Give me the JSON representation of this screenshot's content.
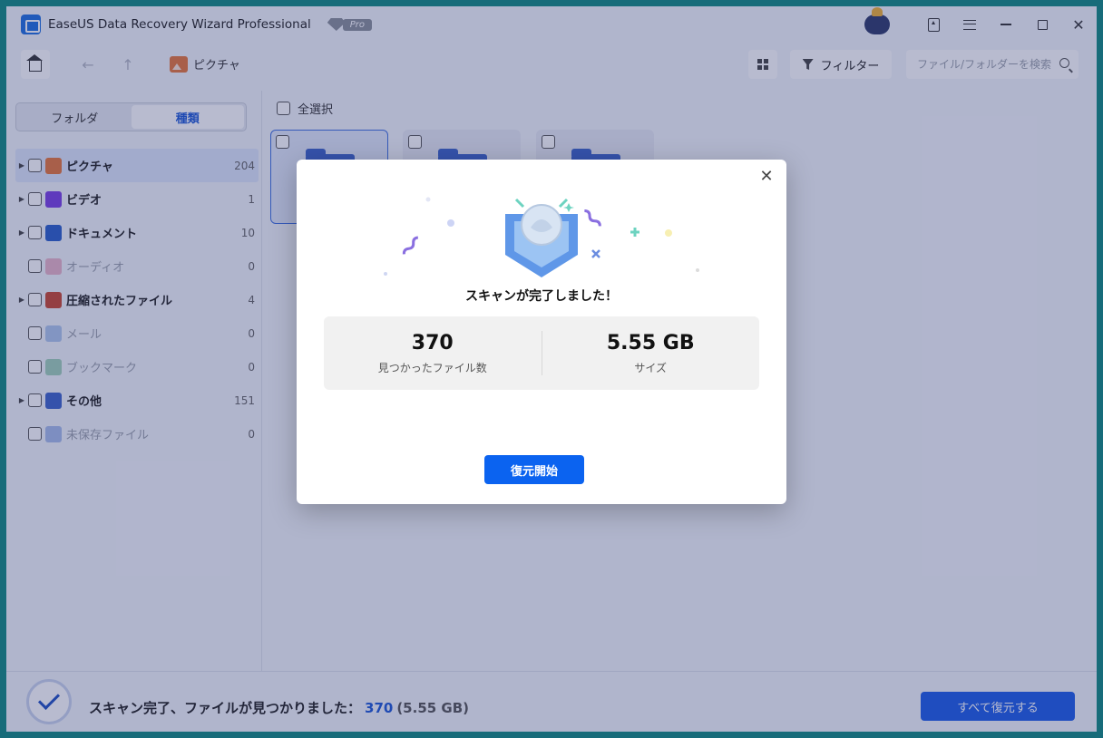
{
  "app": {
    "title": "EaseUS Data Recovery Wizard Professional",
    "badge": "Pro"
  },
  "toolbar": {
    "breadcrumb": "ピクチャ",
    "filter_label": "フィルター",
    "search_placeholder": "ファイル/フォルダーを検索"
  },
  "sidebar": {
    "tabs": [
      {
        "label": "フォルダ",
        "active": false
      },
      {
        "label": "種類",
        "active": true
      }
    ],
    "categories": [
      {
        "label": "ピクチャ",
        "count": "204",
        "icon": "picture-icon",
        "color": "#e8773a",
        "expandable": true,
        "selected": true,
        "enabled": true
      },
      {
        "label": "ビデオ",
        "count": "1",
        "icon": "video-icon",
        "color": "#7b3fe4",
        "expandable": true,
        "selected": false,
        "enabled": true
      },
      {
        "label": "ドキュメント",
        "count": "10",
        "icon": "document-icon",
        "color": "#2a5fc9",
        "expandable": true,
        "selected": false,
        "enabled": true
      },
      {
        "label": "オーディオ",
        "count": "0",
        "icon": "audio-icon",
        "color": "#e0668a",
        "expandable": false,
        "selected": false,
        "enabled": false
      },
      {
        "label": "圧縮されたファイル",
        "count": "4",
        "icon": "archive-icon",
        "color": "#c9462f",
        "expandable": true,
        "selected": false,
        "enabled": true
      },
      {
        "label": "メール",
        "count": "0",
        "icon": "mail-icon",
        "color": "#5b8fd9",
        "expandable": false,
        "selected": false,
        "enabled": false
      },
      {
        "label": "ブックマーク",
        "count": "0",
        "icon": "bookmark-icon",
        "color": "#3fa36b",
        "expandable": false,
        "selected": false,
        "enabled": false
      },
      {
        "label": "その他",
        "count": "151",
        "icon": "folder-icon",
        "color": "#3d63c9",
        "expandable": true,
        "selected": false,
        "enabled": true
      },
      {
        "label": "未保存ファイル",
        "count": "0",
        "icon": "unsaved-file-icon",
        "color": "#4a78d6",
        "expandable": false,
        "selected": false,
        "enabled": false
      }
    ]
  },
  "content": {
    "select_all": "全選択"
  },
  "status": {
    "text": "スキャン完了、ファイルが見つかりました：",
    "count": "370",
    "size": "(5.55 GB)",
    "recover_all": "すべて復元する"
  },
  "modal": {
    "title": "スキャンが完了しました！",
    "files_value": "370",
    "files_label": "見つかったファイル数",
    "size_value": "5.55 GB",
    "size_label": "サイズ",
    "start_button": "復元開始"
  },
  "colors": {
    "accent": "#1b5be8",
    "modal_button": "#0b63f0",
    "overlay": "rgba(40,50,110,0.33)",
    "frame": "#0f8a80"
  }
}
